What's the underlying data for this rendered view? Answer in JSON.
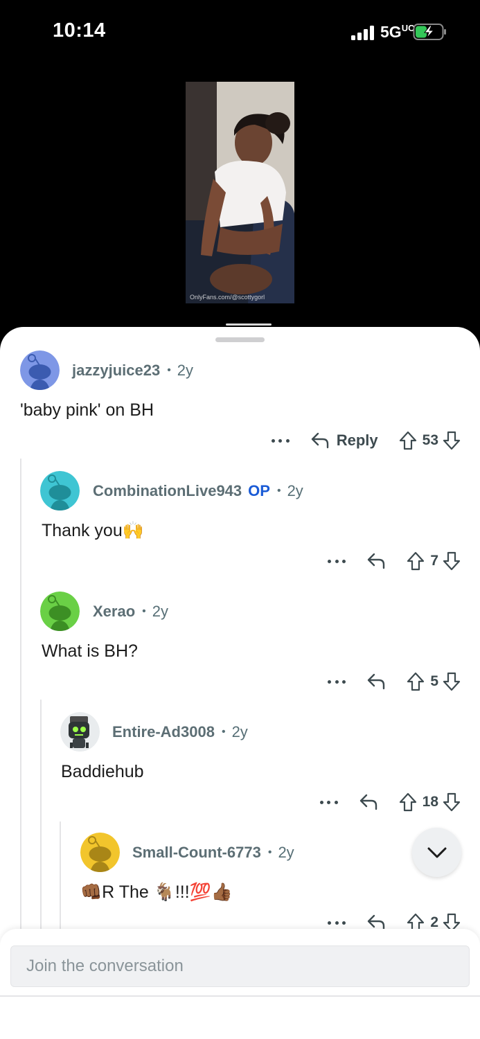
{
  "status_bar": {
    "time": "10:14",
    "network": "5G",
    "network_suffix": "UC",
    "battery_state": "charging"
  },
  "media": {
    "watermark": "OnlyFans.com/@scottygorl",
    "icon": "video-thumbnail"
  },
  "comments": [
    {
      "username": "jazzyjuice23",
      "op": false,
      "age": "2y",
      "body": "'baby pink' on BH",
      "reply_label": "Reply",
      "votes": "53",
      "avatar_color": "#7e97e6",
      "avatar_icon": "snoo-avatar-icon"
    },
    {
      "username": "CombinationLive943",
      "op": true,
      "op_label": "OP",
      "age": "2y",
      "body": "Thank you",
      "body_emoji": "🙌",
      "votes": "7",
      "avatar_color": "#3fc5d3",
      "avatar_icon": "snoo-avatar-icon"
    },
    {
      "username": "Xerao",
      "op": false,
      "age": "2y",
      "body": "What is BH?",
      "votes": "5",
      "avatar_color": "#6ad046",
      "avatar_icon": "snoo-avatar-icon"
    },
    {
      "username": "Entire-Ad3008",
      "op": false,
      "age": "2y",
      "body": "Baddiehub",
      "votes": "18",
      "avatar_color": "#e9ecee",
      "avatar_icon": "robot-avatar-icon"
    },
    {
      "username": "Small-Count-6773",
      "op": false,
      "age": "2y",
      "body_prefix_emoji": "👊🏾",
      "body": "R The",
      "body_suffix": "🐐!!!💯👍🏾",
      "votes": "2",
      "avatar_color": "#f2c52c",
      "avatar_icon": "snoo-avatar-icon"
    }
  ],
  "composer": {
    "placeholder": "Join the conversation"
  },
  "colors": {
    "meta_gray": "#576f76",
    "op_blue": "#1a5bd6",
    "text": "#1c1c1c"
  }
}
